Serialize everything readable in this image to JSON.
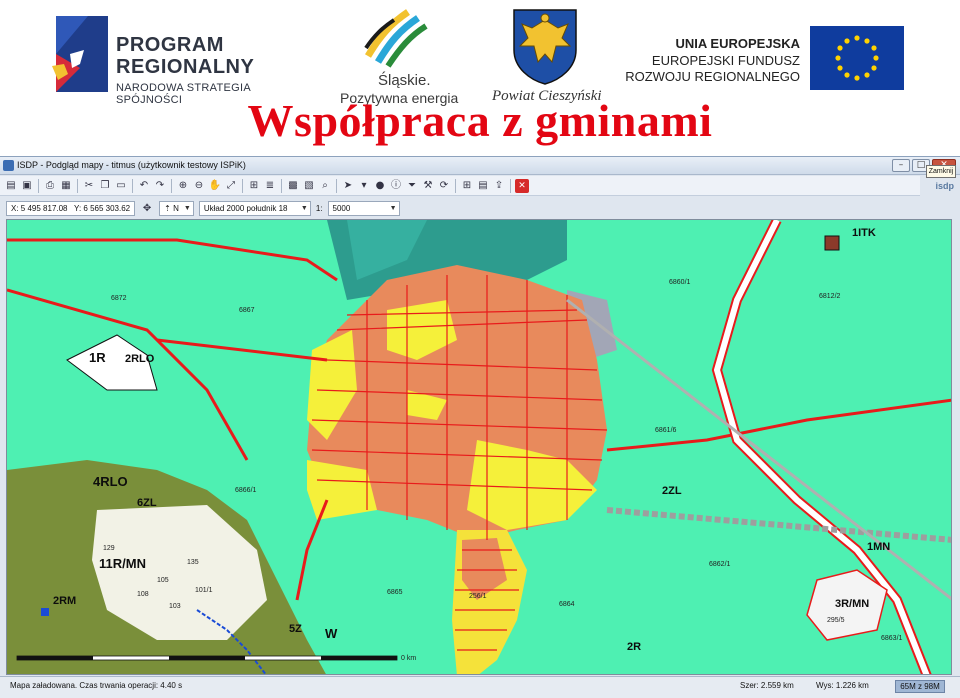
{
  "banner": {
    "program": {
      "line1": "PROGRAM",
      "line2": "REGIONALNY",
      "line3": "NARODOWA STRATEGIA SPÓJNOŚCI"
    },
    "slaskie": {
      "line1": "Śląskie.",
      "line2": "Pozytywna energia"
    },
    "powiat": "Powiat Cieszyński",
    "ue": {
      "line1": "UNIA EUROPEJSKA",
      "line2": "EUROPEJSKI FUNDUSZ",
      "line3": "ROZWOJU REGIONALNEGO"
    },
    "slide_title": "Współpraca z gminami"
  },
  "window": {
    "title": "ISDP - Podgląd mapy - titmus (użytkownik testowy ISPiK)",
    "close_tooltip": "Zamknij",
    "brand": "isdp"
  },
  "coords": {
    "x_label": "X:",
    "x_value": "5 495 817.08",
    "y_label": "Y:",
    "y_value": "6 565 303.62",
    "north": "N",
    "crs": "Układ 2000 południk 18",
    "scale_label": "1:",
    "scale_value": "5000"
  },
  "map": {
    "labels": {
      "r1": "1R",
      "rlo2": "2RLO",
      "itk1": "1ITK",
      "zl2": "2ZL",
      "mn1": "1MN",
      "mn3r": "3R/MN",
      "mn11r": "11R/MN",
      "rlo4": "4RLO",
      "zl6": "6ZL",
      "r2": "2R",
      "w": "W",
      "r2b": "2RM",
      "s5": "5Z"
    },
    "parcels": [
      "6872",
      "6867",
      "6866/1",
      "6861/6",
      "6860/1",
      "6812/2",
      "6863/1",
      "6862/1",
      "6864",
      "6865",
      "256/1",
      "295/5",
      "129",
      "108",
      "105",
      "135",
      "101/1",
      "103"
    ],
    "scalebar": "0 km"
  },
  "status": {
    "message": "Mapa załadowana. Czas trwania operacji: 4.40 s",
    "width": "Szer: 2.559 km",
    "height": "Wys: 1.226 km",
    "memory": "65M z 98M"
  }
}
